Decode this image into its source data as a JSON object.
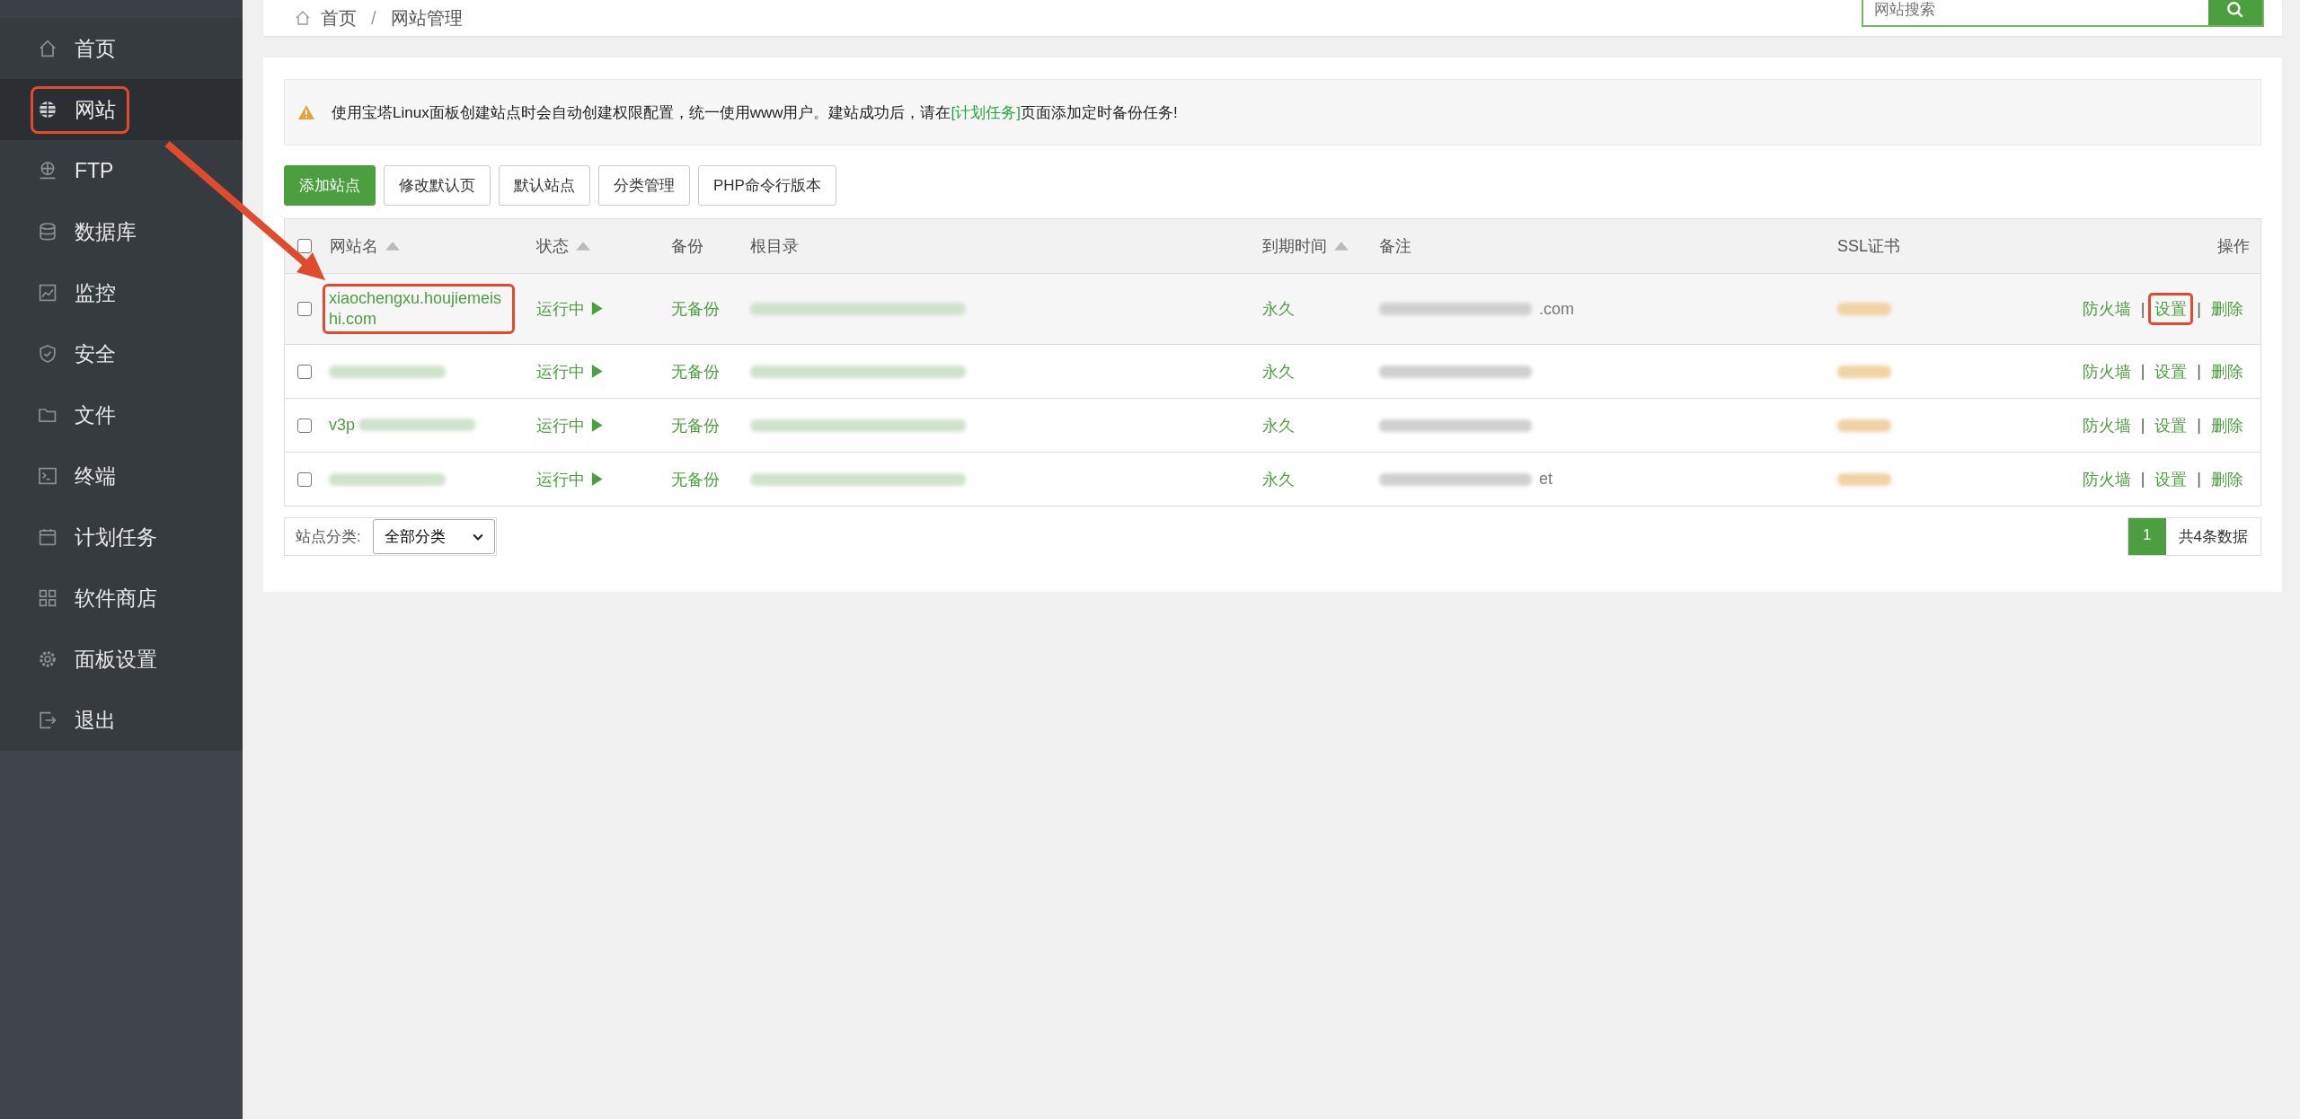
{
  "sidebar": {
    "items": [
      {
        "label": "首页",
        "kind": "home",
        "selected": false,
        "annotated": false
      },
      {
        "label": "网站",
        "kind": "globe",
        "selected": true,
        "annotated": true
      },
      {
        "label": "FTP",
        "kind": "ftp",
        "selected": false,
        "annotated": false
      },
      {
        "label": "数据库",
        "kind": "database",
        "selected": false,
        "annotated": false
      },
      {
        "label": "监控",
        "kind": "monitor",
        "selected": false,
        "annotated": false
      },
      {
        "label": "安全",
        "kind": "shield",
        "selected": false,
        "annotated": false
      },
      {
        "label": "文件",
        "kind": "folder",
        "selected": false,
        "annotated": false
      },
      {
        "label": "终端",
        "kind": "terminal",
        "selected": false,
        "annotated": false
      },
      {
        "label": "计划任务",
        "kind": "calendar",
        "selected": false,
        "annotated": false
      },
      {
        "label": "软件商店",
        "kind": "grid",
        "selected": false,
        "annotated": false
      },
      {
        "label": "面板设置",
        "kind": "gear",
        "selected": false,
        "annotated": false
      },
      {
        "label": "退出",
        "kind": "logout",
        "selected": false,
        "annotated": false
      }
    ]
  },
  "breadcrumb": {
    "items": [
      "首页",
      "网站管理"
    ],
    "separator": "/"
  },
  "search": {
    "placeholder": "网站搜索"
  },
  "notice": {
    "text": "使用宝塔Linux面板创建站点时会自动创建权限配置，统一使用www用户。建站成功后，请在",
    "link": "[计划任务]",
    "after": "页面添加定时备份任务!"
  },
  "toolbar": [
    {
      "label": "添加站点",
      "kind": "primary"
    },
    {
      "label": "修改默认页",
      "kind": "default"
    },
    {
      "label": "默认站点",
      "kind": "default"
    },
    {
      "label": "分类管理",
      "kind": "default"
    },
    {
      "label": "PHP命令行版本",
      "kind": "default"
    }
  ],
  "table": {
    "select_all": {
      "checked": false
    },
    "columns": [
      {
        "label": "网站名",
        "sortable": true
      },
      {
        "label": "状态",
        "sortable": true
      },
      {
        "label": "备份",
        "sortable": false
      },
      {
        "label": "根目录",
        "sortable": false
      },
      {
        "label": "到期时间",
        "sortable": true
      },
      {
        "label": "备注",
        "sortable": false
      },
      {
        "label": "SSL证书",
        "sortable": false
      },
      {
        "label": "操作",
        "sortable": false
      }
    ],
    "rows": [
      {
        "checked": false,
        "highlighted": true,
        "name": {
          "text": "xiaochengxu.houjiemeishi.com",
          "redacted": false,
          "annotated": true
        },
        "status": "运行中 ▶",
        "backup": "无备份",
        "root": {
          "redacted": true
        },
        "expiry": "永久",
        "remark": {
          "text": ".com",
          "redacted": true
        },
        "ssl": {
          "redacted": true
        },
        "separator": "|",
        "actions": [
          {
            "label": "防火墙",
            "annotated": false
          },
          {
            "label": "设置",
            "annotated": true
          },
          {
            "label": "删除",
            "annotated": false
          }
        ]
      },
      {
        "checked": false,
        "highlighted": false,
        "name": {
          "redacted": true,
          "annotated": false
        },
        "status": "运行中 ▶",
        "backup": "无备份",
        "root": {
          "redacted": true
        },
        "expiry": "永久",
        "remark": {
          "redacted": true
        },
        "ssl": {
          "redacted": true
        },
        "separator": "|",
        "actions": [
          {
            "label": "防火墙",
            "annotated": false
          },
          {
            "label": "设置",
            "annotated": false
          },
          {
            "label": "删除",
            "annotated": false
          }
        ]
      },
      {
        "checked": false,
        "highlighted": false,
        "separator": "|",
        "name": {
          "text": "v3p",
          "redacted": true,
          "annotated": false
        },
        "status": "运行中 ▶",
        "backup": "无备份",
        "root": {
          "redacted": true
        },
        "expiry": "永久",
        "remark": {
          "redacted": true
        },
        "ssl": {
          "redacted": true
        },
        "actions": [
          {
            "label": "防火墙",
            "annotated": false
          },
          {
            "label": "设置",
            "annotated": false
          },
          {
            "label": "删除",
            "annotated": false
          }
        ]
      },
      {
        "checked": false,
        "highlighted": false,
        "separator": "|",
        "name": {
          "redacted": true,
          "annotated": false
        },
        "status": "运行中 ▶",
        "backup": "无备份",
        "root": {
          "redacted": true
        },
        "expiry": "永久",
        "remark": {
          "text": "et",
          "redacted": true
        },
        "ssl": {
          "redacted": true
        },
        "actions": [
          {
            "label": "防火墙",
            "annotated": false
          },
          {
            "label": "设置",
            "annotated": false
          },
          {
            "label": "删除",
            "annotated": false
          }
        ]
      }
    ]
  },
  "footer": {
    "category_label": "站点分类:",
    "category_value": "全部分类",
    "pages": [
      {
        "label": "1",
        "selected": true
      }
    ],
    "total": "共4条数据"
  }
}
